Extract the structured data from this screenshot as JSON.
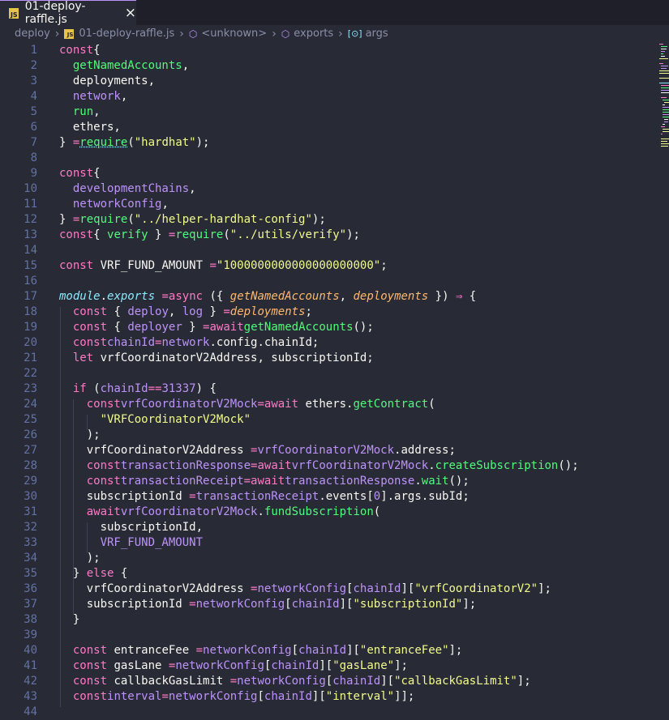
{
  "tab": {
    "icon_text": "JS",
    "label": "01-deploy-raffle.js",
    "close": "×"
  },
  "breadcrumb": {
    "root": "deploy",
    "file": "01-deploy-raffle.js",
    "unknown": "<unknown>",
    "exports": "exports",
    "args": "args"
  },
  "code_lines": [
    {
      "n": "1",
      "t": [
        [
          "k",
          "const"
        ],
        [
          "",
          "{"
        ]
      ]
    },
    {
      "n": "2",
      "t": [
        [
          "",
          "  "
        ],
        [
          "g",
          "getNamedAccounts"
        ],
        [
          "",
          ","
        ]
      ]
    },
    {
      "n": "3",
      "t": [
        [
          "",
          "  deployments,"
        ]
      ]
    },
    {
      "n": "4",
      "t": [
        [
          "",
          "  "
        ],
        [
          "p",
          "network"
        ],
        [
          "",
          ","
        ]
      ]
    },
    {
      "n": "5",
      "t": [
        [
          "",
          "  "
        ],
        [
          "g",
          "run"
        ],
        [
          "",
          ","
        ]
      ]
    },
    {
      "n": "6",
      "t": [
        [
          "",
          "  ethers,"
        ]
      ]
    },
    {
      "n": "7",
      "t": [
        [
          "",
          "} "
        ],
        [
          "k",
          "="
        ],
        [
          "",
          ""
        ],
        [
          "g",
          "require"
        ],
        [
          "",
          "("
        ],
        [
          "s",
          "\"hardhat\""
        ],
        [
          "",
          ");"
        ]
      ]
    },
    {
      "n": "8",
      "t": []
    },
    {
      "n": "9",
      "t": [
        [
          "k",
          "const"
        ],
        [
          "",
          "{"
        ]
      ]
    },
    {
      "n": "10",
      "t": [
        [
          "",
          "  "
        ],
        [
          "p",
          "developmentChains"
        ],
        [
          "",
          ","
        ]
      ]
    },
    {
      "n": "11",
      "t": [
        [
          "",
          "  "
        ],
        [
          "p",
          "networkConfig"
        ],
        [
          "",
          ","
        ]
      ]
    },
    {
      "n": "12",
      "t": [
        [
          "",
          "} "
        ],
        [
          "k",
          "="
        ],
        [
          "",
          ""
        ],
        [
          "g",
          "require"
        ],
        [
          "",
          "("
        ],
        [
          "s",
          "\"../helper-hardhat-config\""
        ],
        [
          "",
          ");"
        ]
      ]
    },
    {
      "n": "13",
      "t": [
        [
          "k",
          "const"
        ],
        [
          "",
          "{ "
        ],
        [
          "g",
          "verify"
        ],
        [
          "",
          " } "
        ],
        [
          "k",
          "="
        ],
        [
          "",
          ""
        ],
        [
          "g",
          "require"
        ],
        [
          "",
          "("
        ],
        [
          "s",
          "\"../utils/verify\""
        ],
        [
          "",
          ");"
        ]
      ]
    },
    {
      "n": "14",
      "t": []
    },
    {
      "n": "15",
      "t": [
        [
          "k",
          "const"
        ],
        [
          "",
          " VRF_FUND_AMOUNT "
        ],
        [
          "k",
          "="
        ],
        [
          "",
          ""
        ],
        [
          "s",
          "\"1000000000000000000000\""
        ],
        [
          "",
          ";"
        ]
      ]
    },
    {
      "n": "16",
      "t": []
    },
    {
      "n": "17",
      "t": [
        [
          "c",
          "module"
        ],
        [
          "",
          "."
        ],
        [
          "c",
          "exports"
        ],
        [
          "",
          " "
        ],
        [
          "k",
          "="
        ],
        [
          "",
          ""
        ],
        [
          "k",
          "async"
        ],
        [
          "",
          " ({ "
        ],
        [
          "i",
          "getNamedAccounts"
        ],
        [
          "",
          ", "
        ],
        [
          "i",
          "deployments"
        ],
        [
          "",
          " }) "
        ],
        [
          "k",
          "⇒"
        ],
        [
          "",
          " {"
        ]
      ]
    },
    {
      "n": "18",
      "t": [
        [
          "",
          "  "
        ],
        [
          "k",
          "const"
        ],
        [
          "",
          " { "
        ],
        [
          "p",
          "deploy"
        ],
        [
          "",
          ", "
        ],
        [
          "p",
          "log"
        ],
        [
          "",
          " } "
        ],
        [
          "k",
          "="
        ],
        [
          "",
          ""
        ],
        [
          "i",
          "deployments"
        ],
        [
          "",
          ";"
        ]
      ]
    },
    {
      "n": "19",
      "t": [
        [
          "",
          "  "
        ],
        [
          "k",
          "const"
        ],
        [
          "",
          " { "
        ],
        [
          "p",
          "deployer"
        ],
        [
          "",
          " } "
        ],
        [
          "k",
          "="
        ],
        [
          "",
          ""
        ],
        [
          "k",
          "await"
        ],
        [
          "",
          ""
        ],
        [
          "g",
          "getNamedAccounts"
        ],
        [
          "",
          "();"
        ]
      ]
    },
    {
      "n": "20",
      "t": [
        [
          "",
          "  "
        ],
        [
          "k",
          "const"
        ],
        [
          "",
          ""
        ],
        [
          "p",
          "chainId"
        ],
        [
          "",
          ""
        ],
        [
          "k",
          "="
        ],
        [
          "",
          ""
        ],
        [
          "p",
          "network"
        ],
        [
          "",
          ".config.chainId;"
        ]
      ]
    },
    {
      "n": "21",
      "t": [
        [
          "",
          "  "
        ],
        [
          "k",
          "let"
        ],
        [
          "",
          " vrfCoordinatorV2Address, subscriptionId;"
        ]
      ]
    },
    {
      "n": "22",
      "t": []
    },
    {
      "n": "23",
      "t": [
        [
          "",
          "  "
        ],
        [
          "k",
          "if"
        ],
        [
          "",
          " ("
        ],
        [
          "p",
          "chainId"
        ],
        [
          "",
          ""
        ],
        [
          "k",
          "=="
        ],
        [
          "",
          ""
        ],
        [
          "p",
          "31337"
        ],
        [
          "",
          ") {"
        ]
      ]
    },
    {
      "n": "24",
      "t": [
        [
          "",
          "    "
        ],
        [
          "k",
          "const"
        ],
        [
          "",
          ""
        ],
        [
          "p",
          "vrfCoordinatorV2Mock"
        ],
        [
          "",
          ""
        ],
        [
          "k",
          "="
        ],
        [
          "",
          ""
        ],
        [
          "k",
          "await"
        ],
        [
          "",
          " ethers."
        ],
        [
          "g",
          "getContract"
        ],
        [
          "",
          "("
        ]
      ]
    },
    {
      "n": "25",
      "t": [
        [
          "",
          "      "
        ],
        [
          "s",
          "\"VRFCoordinatorV2Mock\""
        ]
      ]
    },
    {
      "n": "26",
      "t": [
        [
          "",
          "    );"
        ]
      ]
    },
    {
      "n": "27",
      "t": [
        [
          "",
          "    vrfCoordinatorV2Address "
        ],
        [
          "k",
          "="
        ],
        [
          "",
          ""
        ],
        [
          "p",
          "vrfCoordinatorV2Mock"
        ],
        [
          "",
          ".address;"
        ]
      ]
    },
    {
      "n": "28",
      "t": [
        [
          "",
          "    "
        ],
        [
          "k",
          "const"
        ],
        [
          "",
          ""
        ],
        [
          "p",
          "transactionResponse"
        ],
        [
          "",
          ""
        ],
        [
          "k",
          "="
        ],
        [
          "",
          ""
        ],
        [
          "k",
          "await"
        ],
        [
          "",
          ""
        ],
        [
          "p",
          "vrfCoordinatorV2Mock"
        ],
        [
          "",
          "."
        ],
        [
          "g",
          "createSubscription"
        ],
        [
          "",
          "();"
        ]
      ]
    },
    {
      "n": "29",
      "t": [
        [
          "",
          "    "
        ],
        [
          "k",
          "const"
        ],
        [
          "",
          ""
        ],
        [
          "p",
          "transactionReceipt"
        ],
        [
          "",
          ""
        ],
        [
          "k",
          "="
        ],
        [
          "",
          ""
        ],
        [
          "k",
          "await"
        ],
        [
          "",
          ""
        ],
        [
          "p",
          "transactionResponse"
        ],
        [
          "",
          "."
        ],
        [
          "g",
          "wait"
        ],
        [
          "",
          "();"
        ]
      ]
    },
    {
      "n": "30",
      "t": [
        [
          "",
          "    subscriptionId "
        ],
        [
          "k",
          "="
        ],
        [
          "",
          ""
        ],
        [
          "p",
          "transactionReceipt"
        ],
        [
          "",
          ".events["
        ],
        [
          "p",
          "0"
        ],
        [
          "",
          "].args.subId;"
        ]
      ]
    },
    {
      "n": "31",
      "t": [
        [
          "",
          "    "
        ],
        [
          "k",
          "await"
        ],
        [
          "",
          ""
        ],
        [
          "p",
          "vrfCoordinatorV2Mock"
        ],
        [
          "",
          "."
        ],
        [
          "g",
          "fundSubscription"
        ],
        [
          "",
          "("
        ]
      ]
    },
    {
      "n": "32",
      "t": [
        [
          "",
          "      subscriptionId,"
        ]
      ]
    },
    {
      "n": "33",
      "t": [
        [
          "",
          "      "
        ],
        [
          "p",
          "VRF_FUND_AMOUNT"
        ]
      ]
    },
    {
      "n": "34",
      "t": [
        [
          "",
          "    );"
        ]
      ]
    },
    {
      "n": "35",
      "t": [
        [
          "",
          "  } "
        ],
        [
          "k",
          "else"
        ],
        [
          "",
          " {"
        ]
      ]
    },
    {
      "n": "36",
      "t": [
        [
          "",
          "    vrfCoordinatorV2Address "
        ],
        [
          "k",
          "="
        ],
        [
          "",
          ""
        ],
        [
          "p",
          "networkConfig"
        ],
        [
          "",
          "["
        ],
        [
          "p",
          "chainId"
        ],
        [
          "",
          "]["
        ],
        [
          "s",
          "\"vrfCoordinatorV2\""
        ],
        [
          "",
          "];"
        ]
      ]
    },
    {
      "n": "37",
      "t": [
        [
          "",
          "    subscriptionId "
        ],
        [
          "k",
          "="
        ],
        [
          "",
          ""
        ],
        [
          "p",
          "networkConfig"
        ],
        [
          "",
          "["
        ],
        [
          "p",
          "chainId"
        ],
        [
          "",
          "]["
        ],
        [
          "s",
          "\"subscriptionId\""
        ],
        [
          "",
          "];"
        ]
      ]
    },
    {
      "n": "38",
      "t": [
        [
          "",
          "  }"
        ]
      ]
    },
    {
      "n": "39",
      "t": []
    },
    {
      "n": "40",
      "t": [
        [
          "",
          "  "
        ],
        [
          "k",
          "const"
        ],
        [
          "",
          " entranceFee "
        ],
        [
          "k",
          "="
        ],
        [
          "",
          ""
        ],
        [
          "p",
          "networkConfig"
        ],
        [
          "",
          "["
        ],
        [
          "p",
          "chainId"
        ],
        [
          "",
          "]["
        ],
        [
          "s",
          "\"entranceFee\""
        ],
        [
          "",
          "];"
        ]
      ]
    },
    {
      "n": "41",
      "t": [
        [
          "",
          "  "
        ],
        [
          "k",
          "const"
        ],
        [
          "",
          " gasLane "
        ],
        [
          "k",
          "="
        ],
        [
          "",
          ""
        ],
        [
          "p",
          "networkConfig"
        ],
        [
          "",
          "["
        ],
        [
          "p",
          "chainId"
        ],
        [
          "",
          "]["
        ],
        [
          "s",
          "\"gasLane\""
        ],
        [
          "",
          "];"
        ]
      ]
    },
    {
      "n": "42",
      "t": [
        [
          "",
          "  "
        ],
        [
          "k",
          "const"
        ],
        [
          "",
          " callbackGasLimit "
        ],
        [
          "k",
          "="
        ],
        [
          "",
          ""
        ],
        [
          "p",
          "networkConfig"
        ],
        [
          "",
          "["
        ],
        [
          "p",
          "chainId"
        ],
        [
          "",
          "]["
        ],
        [
          "s",
          "\"callbackGasLimit\""
        ],
        [
          "",
          "];"
        ]
      ]
    },
    {
      "n": "43",
      "t": [
        [
          "",
          "  "
        ],
        [
          "k",
          "const"
        ],
        [
          "",
          ""
        ],
        [
          "p",
          "interval"
        ],
        [
          "",
          ""
        ],
        [
          "k",
          "="
        ],
        [
          "",
          ""
        ],
        [
          "p",
          "networkConfig"
        ],
        [
          "",
          "["
        ],
        [
          "p",
          "chainId"
        ],
        [
          "",
          "]["
        ],
        [
          "s",
          "\"interval\""
        ],
        [
          "",
          "]];"
        ]
      ]
    },
    {
      "n": "44",
      "t": []
    }
  ]
}
